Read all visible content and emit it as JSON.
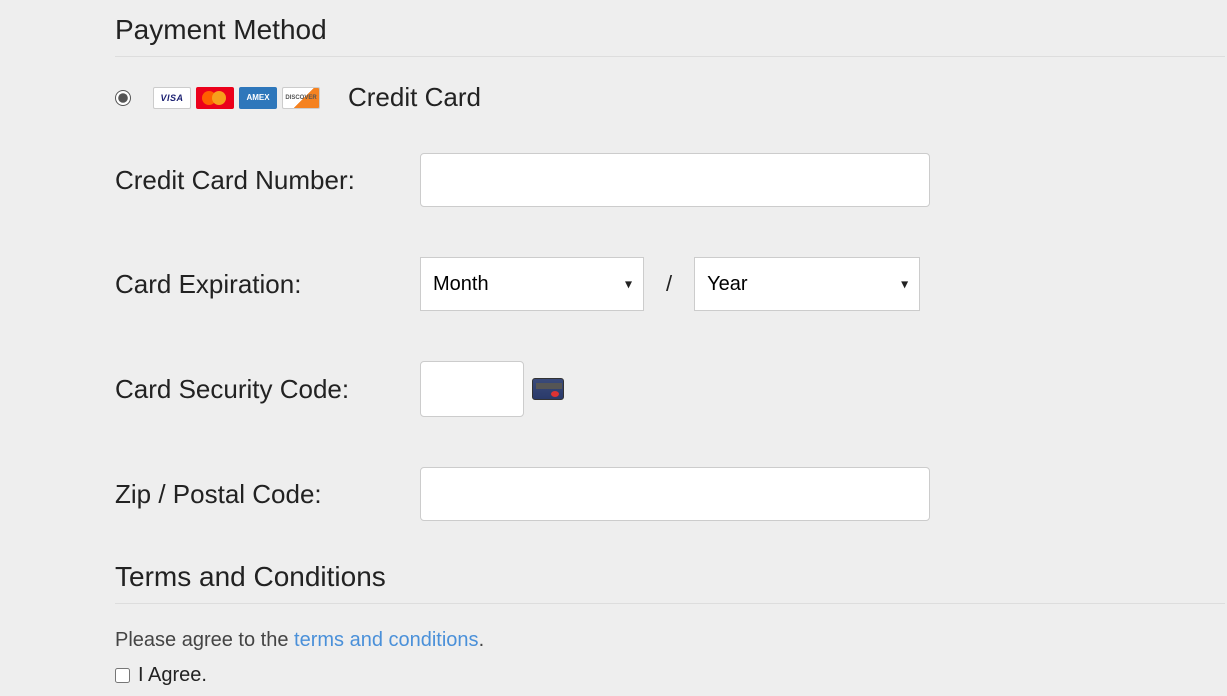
{
  "payment": {
    "section_title": "Payment Method",
    "method_label": "Credit Card",
    "card_icons": [
      "visa",
      "mastercard",
      "amex",
      "discover"
    ],
    "card_number_label": "Credit Card Number:",
    "card_number_value": "",
    "expiration_label": "Card Expiration:",
    "month_placeholder": "Month",
    "year_placeholder": "Year",
    "exp_separator": "/",
    "security_label": "Card Security Code:",
    "security_value": "",
    "zip_label": "Zip / Postal Code:",
    "zip_value": ""
  },
  "terms": {
    "section_title": "Terms and Conditions",
    "please_agree_prefix": "Please agree to the ",
    "link_text": "terms and conditions",
    "please_agree_suffix": ".",
    "checkbox_label": "I Agree."
  }
}
